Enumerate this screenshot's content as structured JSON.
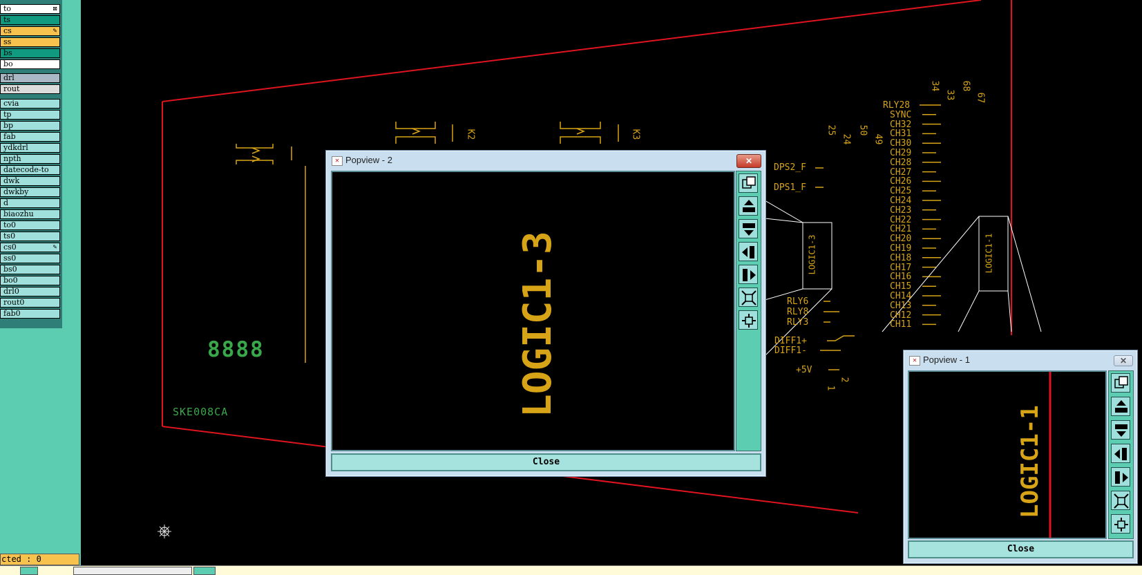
{
  "layers": {
    "group1": [
      {
        "label": "to",
        "color": "#ffffff",
        "mark": "⊠"
      },
      {
        "label": "ts",
        "color": "#109a80",
        "mark": ""
      },
      {
        "label": "cs",
        "color": "#f7c24e",
        "mark": "✎"
      },
      {
        "label": "ss",
        "color": "#f7c24e",
        "mark": ""
      },
      {
        "label": "bs",
        "color": "#109a80",
        "mark": ""
      },
      {
        "label": "bo",
        "color": "#ffffff",
        "mark": ""
      }
    ],
    "group2": [
      {
        "label": "drl",
        "color": "#a9b8c4",
        "mark": ""
      },
      {
        "label": "rout",
        "color": "#dcdcdc",
        "mark": ""
      }
    ],
    "group3": [
      {
        "label": "cvia",
        "mark": ""
      },
      {
        "label": "tp",
        "mark": ""
      },
      {
        "label": "bp",
        "mark": ""
      },
      {
        "label": "fab",
        "mark": ""
      },
      {
        "label": "ydkdrl",
        "mark": ""
      },
      {
        "label": "npth",
        "mark": ""
      },
      {
        "label": "datecode-to",
        "mark": ""
      },
      {
        "label": "dwk",
        "mark": ""
      },
      {
        "label": "dwkby",
        "mark": ""
      },
      {
        "label": "d",
        "mark": ""
      },
      {
        "label": "biaozhu",
        "mark": ""
      },
      {
        "label": "to0",
        "mark": ""
      },
      {
        "label": "ts0",
        "mark": ""
      },
      {
        "label": "cs0",
        "mark": "✎"
      },
      {
        "label": "ss0",
        "mark": ""
      },
      {
        "label": "bs0",
        "mark": ""
      },
      {
        "label": "bo0",
        "mark": ""
      },
      {
        "label": "drl0",
        "mark": ""
      },
      {
        "label": "rout0",
        "mark": ""
      },
      {
        "label": "fab0",
        "mark": ""
      }
    ]
  },
  "status": {
    "selected": "cted : 0"
  },
  "board": {
    "part_number": "SKE008CA",
    "display_digits": "8888",
    "relay_labels": [
      "K2",
      "K3"
    ],
    "pin_numbers": [
      "25",
      "24",
      "50",
      "49",
      "34",
      "33",
      "68",
      "67",
      "2",
      "1"
    ],
    "left_nets": [
      "DPS2_F",
      "DPS1_F",
      "RLY6",
      "RLY8",
      "RLY3",
      "DIFF1+",
      "DIFF1-",
      "+5V"
    ],
    "right_nets": [
      "RLY28",
      "SYNC",
      "CH32",
      "CH31",
      "CH30",
      "CH29",
      "CH28",
      "CH27",
      "CH26",
      "CH25",
      "CH24",
      "CH23",
      "CH22",
      "CH21",
      "CH20",
      "CH19",
      "CH18",
      "CH17",
      "CH16",
      "CH15",
      "CH14",
      "CH13",
      "CH12",
      "CH11"
    ],
    "zoom_text_3": "LOGIC1-3",
    "zoom_text_1": "LOGIC1-1",
    "colors": {
      "outline": "#e0141e",
      "silk": "#d7a417",
      "green": "#38a84a"
    }
  },
  "popview2": {
    "title": "Popview - 2",
    "close_label": "Close",
    "zoom_text": "LOGIC1-3",
    "close_icon": "close-x-icon"
  },
  "popview1": {
    "title": "Popview - 1",
    "close_label": "Close",
    "zoom_text": "LOGIC1-1",
    "close_icon": "close-x-icon"
  },
  "toolbar_icons": [
    "zoom-fit-icon",
    "pan-up-icon",
    "pan-down-icon",
    "pan-left-icon",
    "pan-right-icon",
    "zoom-in-icon",
    "zoom-out-icon"
  ]
}
